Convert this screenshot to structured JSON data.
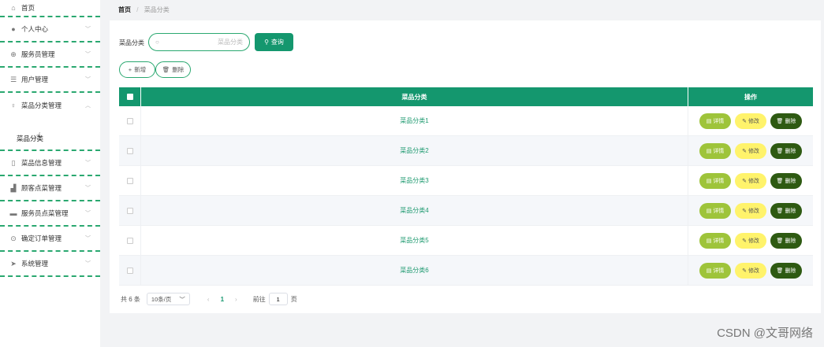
{
  "sidebar": {
    "items": [
      {
        "label": "首页",
        "icon": "home-icon"
      },
      {
        "label": "个人中心",
        "icon": "user-icon"
      },
      {
        "label": "服务员管理",
        "icon": "globe-icon"
      },
      {
        "label": "用户管理",
        "icon": "list-icon"
      },
      {
        "label": "菜品分类管理",
        "icon": "mic-icon"
      },
      {
        "label": "菜品信息管理",
        "icon": "phone-icon"
      },
      {
        "label": "顾客点菜管理",
        "icon": "chart-icon"
      },
      {
        "label": "服务员点菜管理",
        "icon": "briefcase-icon"
      },
      {
        "label": "确定订单管理",
        "icon": "help-icon"
      },
      {
        "label": "系统管理",
        "icon": "send-icon"
      }
    ],
    "submenu_item": "菜品分类"
  },
  "breadcrumb": {
    "home": "首页",
    "separator": "/",
    "current": "菜品分类"
  },
  "search": {
    "label": "菜品分类",
    "placeholder": "菜品分类",
    "button": "查询"
  },
  "actions": {
    "add": "新增",
    "delete": "删除"
  },
  "table": {
    "headers": {
      "category": "菜品分类",
      "operations": "操作"
    },
    "rows": [
      {
        "category": "菜品分类1"
      },
      {
        "category": "菜品分类2"
      },
      {
        "category": "菜品分类3"
      },
      {
        "category": "菜品分类4"
      },
      {
        "category": "菜品分类5"
      },
      {
        "category": "菜品分类6"
      }
    ],
    "ops": {
      "detail": "详情",
      "edit": "修改",
      "delete": "删除"
    }
  },
  "pagination": {
    "total": "共 6 条",
    "page_size": "10条/页",
    "current_page": "1",
    "goto_label": "前往",
    "goto_value": "1",
    "page_unit": "页"
  },
  "colors": {
    "primary": "#14976e",
    "detail": "#9ec43a",
    "edit": "#fff36b",
    "delete": "#2e5a12"
  },
  "watermark": "CSDN @文哥网络"
}
